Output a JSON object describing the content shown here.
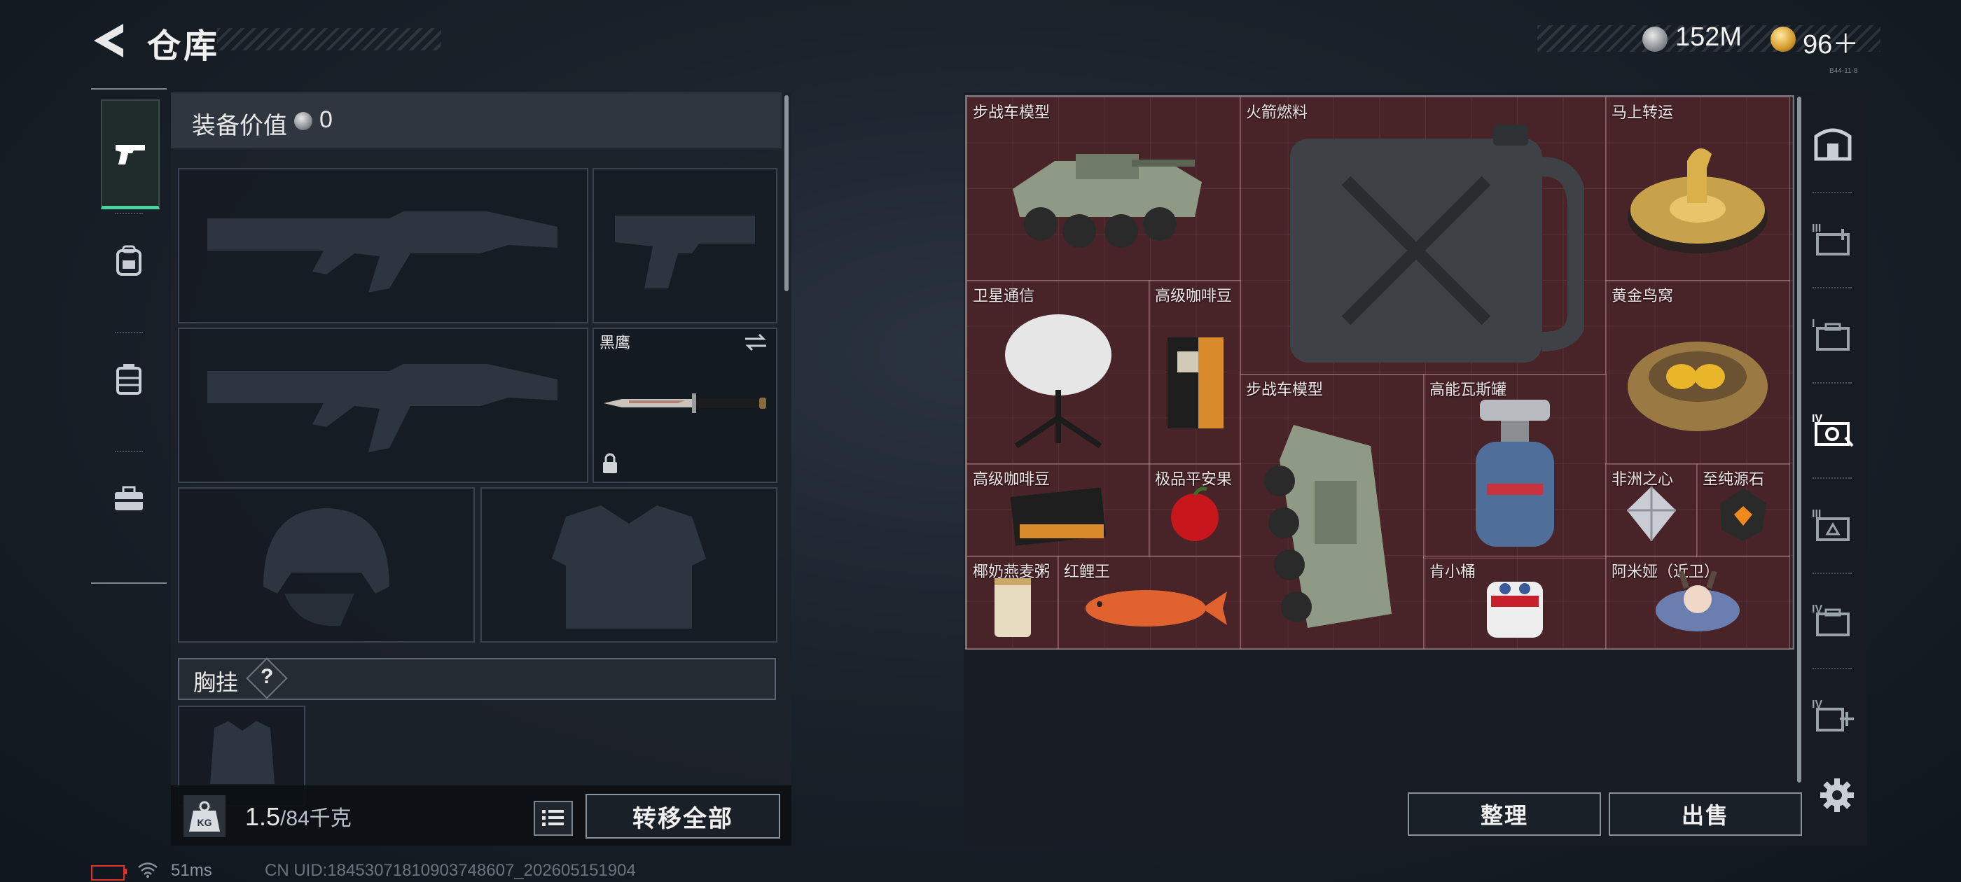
{
  "header": {
    "title": "仓库",
    "currency_silver": "152M",
    "currency_gold": "96＋",
    "tiny_text": "B44-11-8"
  },
  "left_nav": [
    {
      "name": "weapons",
      "icon": "pistol-icon",
      "active": true
    },
    {
      "name": "backpack",
      "icon": "backpack-icon"
    },
    {
      "name": "vest",
      "icon": "chest-rig-icon"
    },
    {
      "name": "case",
      "icon": "toolbox-icon"
    }
  ],
  "equipment": {
    "value_label": "装备价值",
    "value": "0",
    "melee_name": "黑鹰",
    "chest_label": "胸挂",
    "chest_help": "?",
    "weight_current": "1.5",
    "weight_cap": "/84千克",
    "transfer_all": "转移全部"
  },
  "storage": {
    "items": [
      {
        "label": "步战车模型"
      },
      {
        "label": "火箭燃料"
      },
      {
        "label": "马上转运"
      },
      {
        "label": "卫星通信"
      },
      {
        "label": "高级咖啡豆"
      },
      {
        "label": "黄金鸟窝"
      },
      {
        "label": "步战车模型"
      },
      {
        "label": "高能瓦斯罐"
      },
      {
        "label": "高级咖啡豆"
      },
      {
        "label": "极品平安果"
      },
      {
        "label": "非洲之心"
      },
      {
        "label": "至纯源石"
      },
      {
        "label": "椰奶燕麦粥"
      },
      {
        "label": "红鲤王"
      },
      {
        "label": "肯小桶"
      },
      {
        "label": "阿米娅（近卫）"
      }
    ],
    "sort_button": "整理",
    "sell_button": "出售"
  },
  "right_nav": [
    {
      "icon": "safe-box-icon"
    },
    {
      "icon": "level-3-storage-icon",
      "tier": "III"
    },
    {
      "icon": "level-1-storage-icon",
      "tier": "I"
    },
    {
      "icon": "level-4-camera-icon",
      "tier": "IV",
      "active": true
    },
    {
      "icon": "level-3-storage-icon-b",
      "tier": "III"
    },
    {
      "icon": "level-4-storage-icon",
      "tier": "IV"
    },
    {
      "icon": "level-4-add-icon",
      "tier": "IV"
    }
  ],
  "status_bar": {
    "ping": "51ms",
    "uid": "CN UID:18453071810903748607_202605151904"
  },
  "colors": {
    "accent": "#4fd0a0",
    "grid_bg": "#3a2226",
    "battery": "#e0312b"
  }
}
